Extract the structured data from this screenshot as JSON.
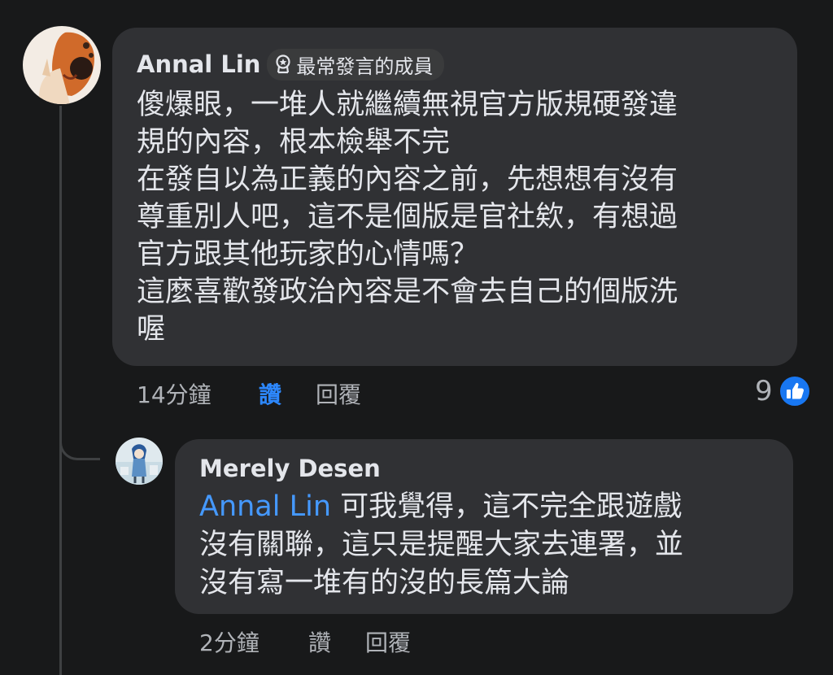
{
  "comment": {
    "author": "Annal Lin",
    "badge": "最常發言的成員",
    "lines": [
      "傻爆眼，一堆人就繼續無視官方版規硬發違",
      "規的內容，根本檢舉不完",
      "在發自以為正義的內容之前，先想想有沒有",
      "尊重別人吧，這不是個版是官社欸，有想過",
      "官方跟其他玩家的心情嗎？",
      "這麼喜歡發政治內容是不會去自己的個版洗",
      "喔"
    ],
    "time": "14分鐘",
    "like_label": "讚",
    "reply_label": "回覆",
    "reaction_count": "9",
    "reaction_icon": "like-thumb-icon",
    "reaction_color": "#1877f2"
  },
  "reply": {
    "author": "Merely Desen",
    "mention": "Annal Lin",
    "line1_rest": " 可我覺得，這不完全跟遊戲",
    "line2": "沒有關聯，這只是提醒大家去連署，並",
    "line3": "沒有寫一堆有的沒的長篇大論",
    "time": "2分鐘",
    "like_label": "讚",
    "reply_label": "回覆"
  },
  "colors": {
    "background": "#18191a",
    "bubble": "#303134",
    "link": "#4599ff",
    "liked": "#2d88ff"
  }
}
